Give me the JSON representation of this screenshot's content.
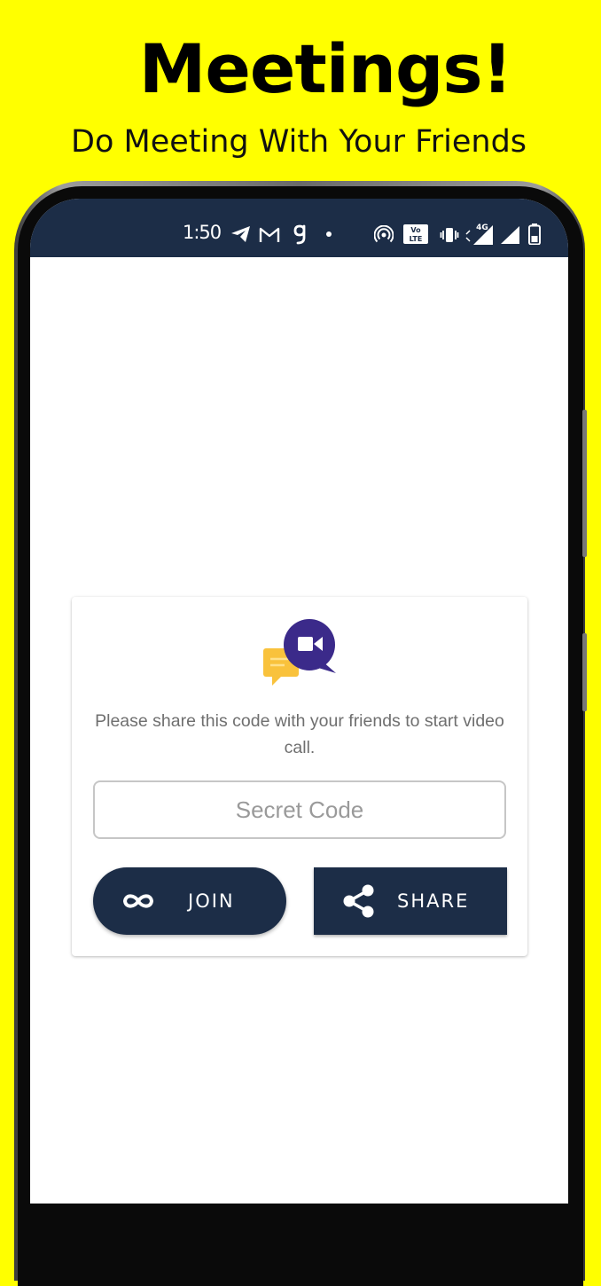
{
  "promo": {
    "title": "Meetings!",
    "subtitle": "Do Meeting With Your Friends"
  },
  "status_bar": {
    "time": "1:50",
    "icons": [
      "telegram-icon",
      "gmail-icon",
      "g-icon",
      "dot-icon",
      "hotspot-icon",
      "volte-icon",
      "vibrate-icon",
      "signal-4g-icon",
      "signal-icon",
      "battery-icon"
    ],
    "network_label": "4G"
  },
  "card": {
    "logo": "video-chat-logo",
    "info_text": "Please share this code with your friends to start video call.",
    "code_input": {
      "value": "",
      "placeholder": "Secret Code"
    },
    "join_button": {
      "label": "JOIN",
      "icon": "infinity-icon"
    },
    "share_button": {
      "label": "SHARE",
      "icon": "share-icon"
    }
  },
  "colors": {
    "background": "#FFFF00",
    "primary": "#1C2D47",
    "logo_purple": "#3B2A8A",
    "logo_yellow": "#F9C23C"
  }
}
